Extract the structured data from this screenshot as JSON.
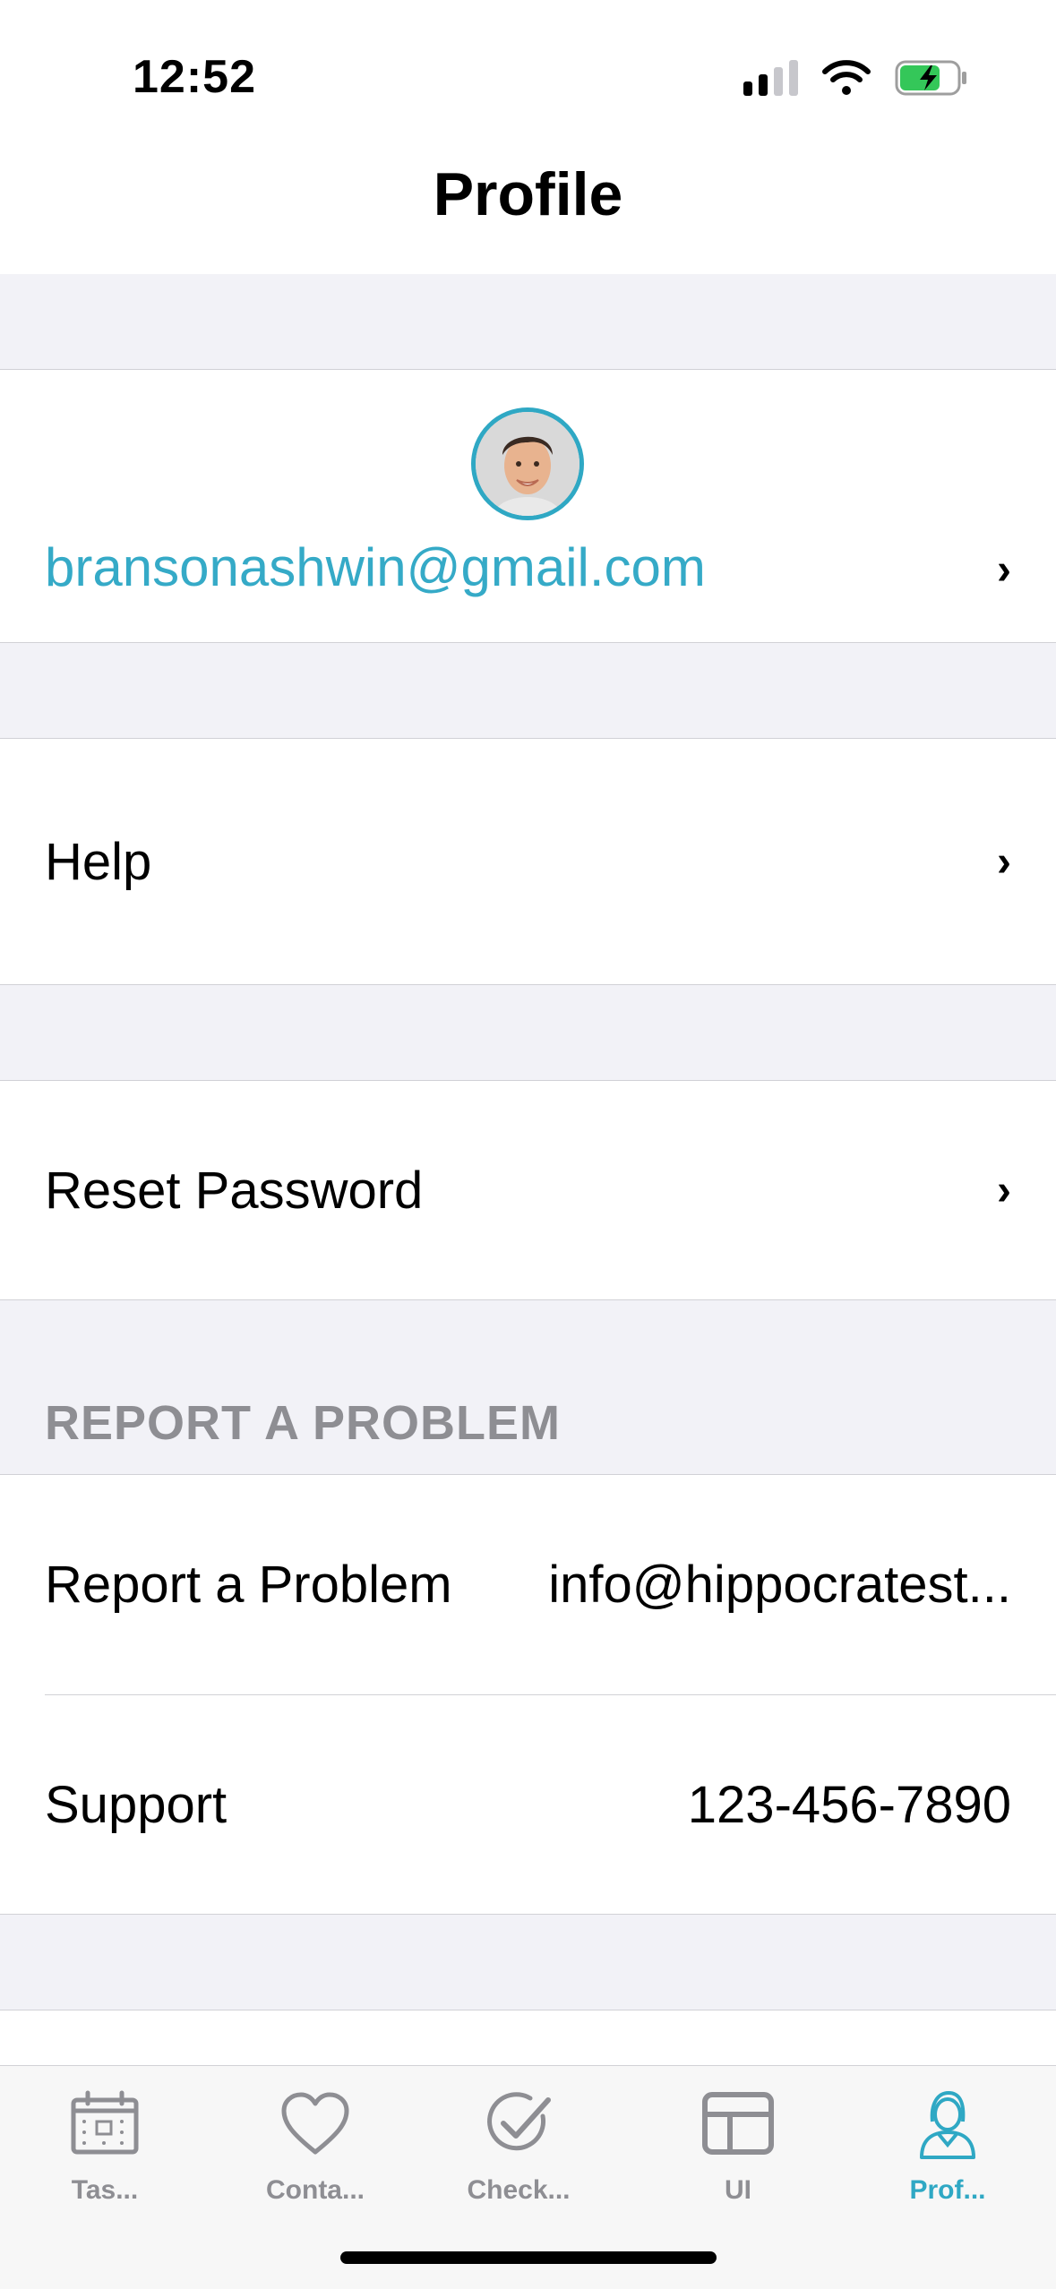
{
  "status_bar": {
    "time": "12:52",
    "icons": [
      "signal-icon",
      "wifi-icon",
      "battery-charging-icon"
    ]
  },
  "nav": {
    "title": "Profile"
  },
  "profile": {
    "email": "bransonashwin@gmail.com",
    "avatar_icon": "avatar-photo"
  },
  "menu": {
    "help_label": "Help",
    "reset_password_label": "Reset Password"
  },
  "report_section": {
    "header": "REPORT A PROBLEM",
    "rows": [
      {
        "label": "Report a Problem",
        "value": "info@hippocratest..."
      },
      {
        "label": "Support",
        "value": "123-456-7890"
      }
    ]
  },
  "tab_bar": {
    "tabs": [
      {
        "label": "Tas...",
        "icon": "calendar-icon",
        "active": false
      },
      {
        "label": "Conta...",
        "icon": "heart-icon",
        "active": false
      },
      {
        "label": "Check...",
        "icon": "check-circle-icon",
        "active": false
      },
      {
        "label": "UI",
        "icon": "layout-icon",
        "active": false
      },
      {
        "label": "Prof...",
        "icon": "person-icon",
        "active": true
      }
    ]
  },
  "colors": {
    "accent": "#2fa8c4",
    "background": "#f2f2f7",
    "separator": "#d1d1d6",
    "secondary_text": "#8e8e93",
    "battery_green": "#34c759"
  }
}
